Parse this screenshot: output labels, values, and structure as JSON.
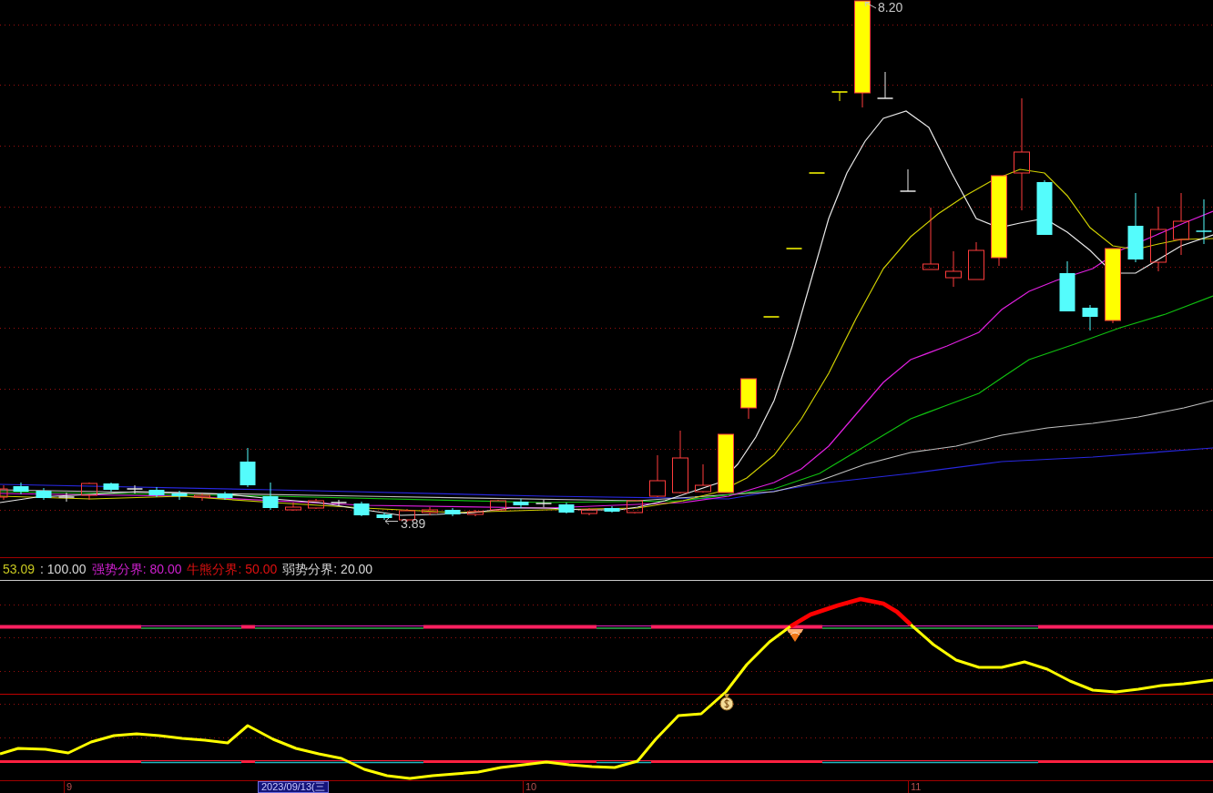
{
  "price_panel": {
    "high_label": "8.20",
    "low_label": "3.89"
  },
  "indicator_panel": {
    "legend": [
      {
        "text": "53.09",
        "color": "#c8c820"
      },
      {
        "text": ": 100.00",
        "color": "#d8d8d8"
      },
      {
        "text": "强势分界: 80.00",
        "color": "#d020d0"
      },
      {
        "text": "牛熊分界: 50.00",
        "color": "#e01010"
      },
      {
        "text": "弱势分界: 20.00",
        "color": "#d8d8d8"
      }
    ]
  },
  "time_axis": {
    "month_labels": [
      "9",
      "10",
      "11"
    ],
    "cursor_date": "2023/09/13(三"
  }
}
